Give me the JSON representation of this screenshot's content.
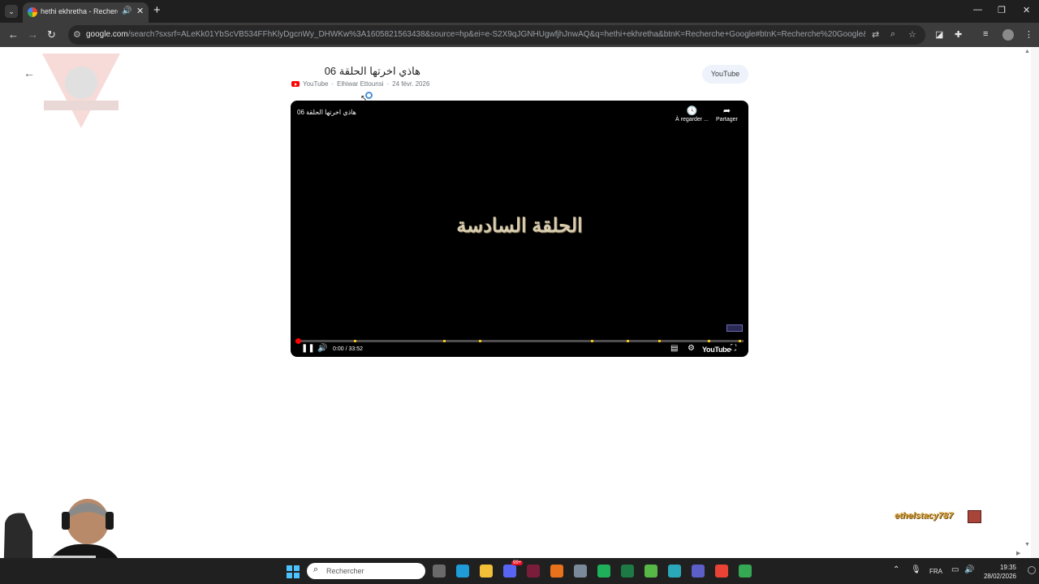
{
  "browser": {
    "tab_title": "hethi ekhretha - Recherche",
    "url_host": "google.com",
    "url_rest": "/search?sxsrf=ALeKk01YbScVB534FFhKlyDgcnWy_DHWKw%3A1605821563438&source=hp&ei=e-S2X9qJGNHUgwfjhJnwAQ&q=hethi+ekhretha&btnK=Recherche+Google#btnK=Recherche%20Google&fpstate=ive&vld..."
  },
  "video": {
    "title": "هاذي اخرتها الحلقة 06",
    "source": "YouTube",
    "channel": "Elhiwar Ettounsi",
    "date": "24 févr. 2026",
    "meta_separator": "·",
    "chip_label": "YouTube"
  },
  "player": {
    "title": "هاذي اخرتها الحلقة 06",
    "watch_later_label": "À regarder ...",
    "share_label": "Partager",
    "center_text": "الحلقة السادسة",
    "time": "0:00 / 33:52",
    "progress": 0.0,
    "chapter_marks": [
      0.13,
      0.33,
      0.41,
      0.66,
      0.74,
      0.81,
      0.92,
      0.99
    ],
    "logo_text": "YouTube"
  },
  "stream": {
    "username": "ethelstacy787"
  },
  "taskbar": {
    "search_placeholder": "Rechercher",
    "lang": "FRA",
    "time": "19:35",
    "date": "28/02/2026",
    "discord_badge": "99+",
    "apps": [
      {
        "name": "task-view",
        "color": "#6a6a6a"
      },
      {
        "name": "edge",
        "color": "#1f9bd8"
      },
      {
        "name": "file-explorer",
        "color": "#f2c037"
      },
      {
        "name": "discord",
        "color": "#5865f2"
      },
      {
        "name": "affinity",
        "color": "#7a1d3a"
      },
      {
        "name": "firefox",
        "color": "#e8721c"
      },
      {
        "name": "calculator",
        "color": "#7a8a9a"
      },
      {
        "name": "app-green",
        "color": "#1fb15a"
      },
      {
        "name": "excel",
        "color": "#1d7a44"
      },
      {
        "name": "bluestacks",
        "color": "#58b847"
      },
      {
        "name": "edge-beta",
        "color": "#2aa7b8"
      },
      {
        "name": "teams",
        "color": "#5b5fc7"
      },
      {
        "name": "chrome",
        "color": "#ea4335"
      },
      {
        "name": "chrome-2",
        "color": "#34a853"
      }
    ]
  }
}
